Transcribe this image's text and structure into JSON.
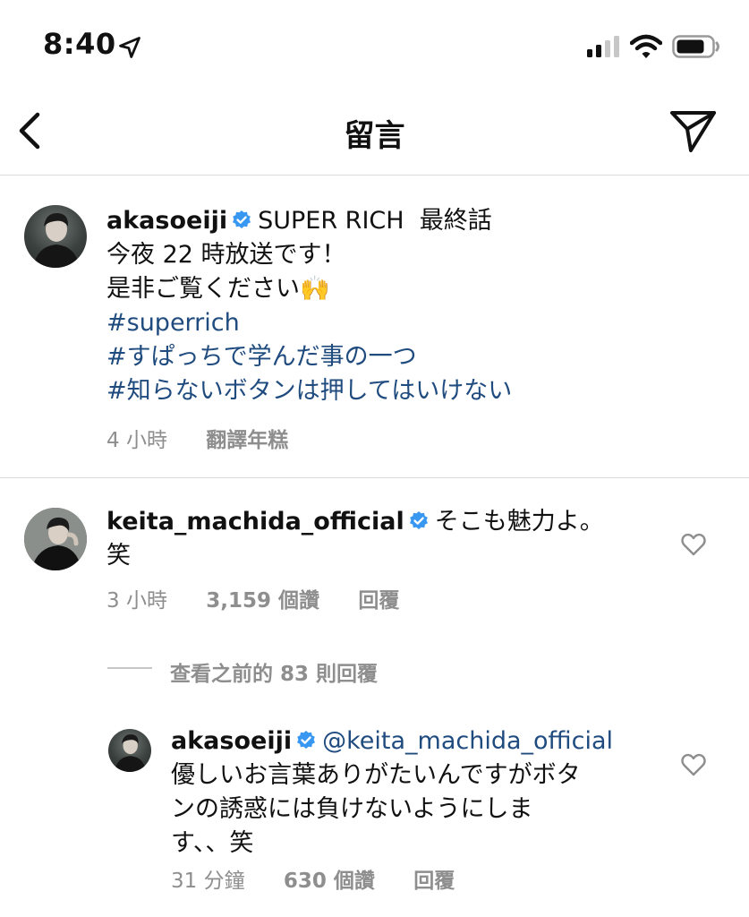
{
  "status_bar": {
    "time": "8:40"
  },
  "nav": {
    "title": "留言"
  },
  "caption": {
    "username": "akasoeiji",
    "title_text": "SUPER RICH  最終話",
    "line2": "今夜 22 時放送です！",
    "line3": "是非ご覧ください🙌",
    "hashtags": [
      "#superrich",
      "#すぱっちで学んだ事の一つ",
      "#知らないボタンは押してはいけない"
    ],
    "time": "4 小時",
    "translate": "翻譯年糕"
  },
  "comment": {
    "username": "keita_machida_official",
    "text_line1": "そこも魅力よ。",
    "text_line2": "笑",
    "time": "3 小時",
    "likes": "3,159 個讚",
    "reply": "回覆"
  },
  "view_replies": "查看之前的 83 則回覆",
  "reply": {
    "username": "akasoeiji",
    "mention": "@keita_machida_official",
    "text_line1": "優しいお言葉ありがたいんですがボタ",
    "text_line2": "ンの誘惑には負けないようにしま",
    "text_line3": "す、、笑",
    "time": "31 分鐘",
    "likes": "630 個讚",
    "reply": "回覆"
  },
  "colors": {
    "link": "#1f4b7f",
    "verified": "#3897f0",
    "muted": "#8e8e8e"
  }
}
